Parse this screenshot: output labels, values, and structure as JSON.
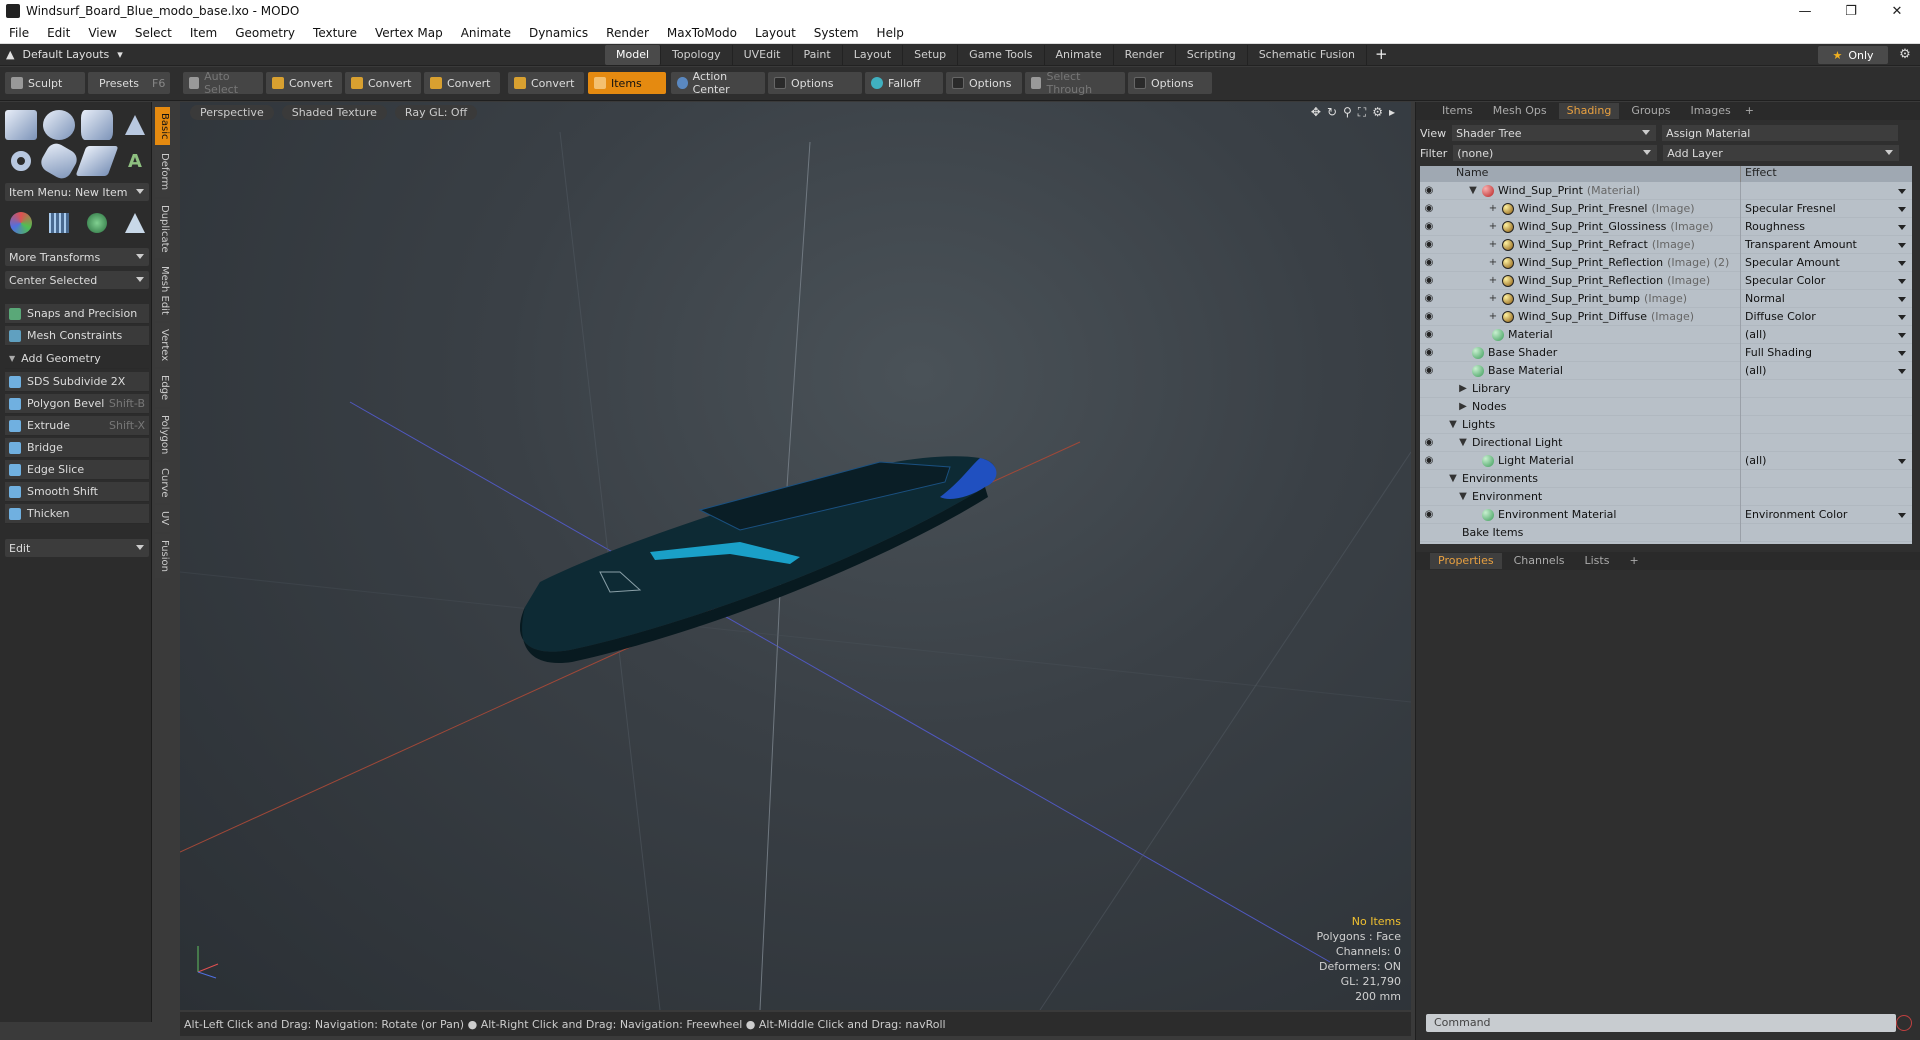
{
  "window": {
    "title": "Windsurf_Board_Blue_modo_base.lxo - MODO"
  },
  "menu": [
    "File",
    "Edit",
    "View",
    "Select",
    "Item",
    "Geometry",
    "Texture",
    "Vertex Map",
    "Animate",
    "Dynamics",
    "Render",
    "MaxToModo",
    "Layout",
    "System",
    "Help"
  ],
  "layout": {
    "default_layouts": "Default Layouts",
    "tabs": [
      "Model",
      "Topology",
      "UVEdit",
      "Paint",
      "Layout",
      "Setup",
      "Game Tools",
      "Animate",
      "Render",
      "Scripting",
      "Schematic Fusion"
    ],
    "active_tab": "Model",
    "only_label": "Only"
  },
  "toolbar": {
    "sculpt": "Sculpt",
    "presets": "Presets",
    "presets_key": "F6",
    "auto_select": "Auto Select",
    "convert": "Convert",
    "items": "Items",
    "action_center": "Action Center",
    "options": "Options",
    "falloff": "Falloff",
    "select_through": "Select Through"
  },
  "left": {
    "item_menu": "Item Menu: New Item",
    "more_transforms": "More Transforms",
    "center_selected": "Center Selected",
    "snaps": "Snaps and Precision",
    "mesh_constraints": "Mesh Constraints",
    "add_geometry": "Add Geometry",
    "tools": [
      {
        "label": "SDS Subdivide 2X",
        "key": ""
      },
      {
        "label": "Polygon Bevel",
        "key": "Shift-B"
      },
      {
        "label": "Extrude",
        "key": "Shift-X"
      },
      {
        "label": "Bridge",
        "key": ""
      },
      {
        "label": "Edge Slice",
        "key": ""
      },
      {
        "label": "Smooth Shift",
        "key": ""
      },
      {
        "label": "Thicken",
        "key": ""
      }
    ],
    "edit": "Edit",
    "side_tabs": [
      "Basic",
      "Deform",
      "Duplicate",
      "Mesh Edit",
      "Vertex",
      "Edge",
      "Polygon",
      "Curve",
      "UV",
      "Fusion"
    ]
  },
  "viewport": {
    "perspective": "Perspective",
    "shaded": "Shaded Texture",
    "raygl": "Ray GL: Off",
    "stats": {
      "items": "No Items",
      "polygons": "Polygons : Face",
      "channels": "Channels: 0",
      "deformers": "Deformers: ON",
      "gl": "GL: 21,790",
      "scale": "200 mm"
    },
    "status": "Alt-Left Click and Drag: Navigation: Rotate (or Pan) ● Alt-Right Click and Drag: Navigation: Freewheel ● Alt-Middle Click and Drag: navRoll"
  },
  "right": {
    "tabs": [
      "Items",
      "Mesh Ops",
      "Shading",
      "Groups",
      "Images"
    ],
    "active_tab": "Shading",
    "view_label": "View",
    "view_value": "Shader Tree",
    "assign_material": "Assign Material",
    "filter_label": "Filter",
    "filter_value": "(none)",
    "add_layer": "Add Layer",
    "col_name": "Name",
    "col_effect": "Effect",
    "tree": [
      {
        "name": "Wind_Sup_Print",
        "type": "(Material)",
        "effect": "",
        "eye": true,
        "indent": 3,
        "ball": "red",
        "expander": "▼",
        "arrow": true
      },
      {
        "name": "Wind_Sup_Print_Fresnel",
        "type": "(Image)",
        "effect": "Specular Fresnel",
        "eye": true,
        "indent": 5,
        "ball": "img",
        "expander": "+",
        "arrow": true
      },
      {
        "name": "Wind_Sup_Print_Glossiness",
        "type": "(Image)",
        "effect": "Roughness",
        "eye": true,
        "indent": 5,
        "ball": "img",
        "expander": "+",
        "arrow": true
      },
      {
        "name": "Wind_Sup_Print_Refract",
        "type": "(Image)",
        "effect": "Transparent Amount",
        "eye": true,
        "indent": 5,
        "ball": "img",
        "expander": "+",
        "arrow": true
      },
      {
        "name": "Wind_Sup_Print_Reflection",
        "type": "(Image) (2)",
        "effect": "Specular Amount",
        "eye": true,
        "indent": 5,
        "ball": "img",
        "expander": "+",
        "arrow": true
      },
      {
        "name": "Wind_Sup_Print_Reflection",
        "type": "(Image)",
        "effect": "Specular Color",
        "eye": true,
        "indent": 5,
        "ball": "img",
        "expander": "+",
        "arrow": true
      },
      {
        "name": "Wind_Sup_Print_bump",
        "type": "(Image)",
        "effect": "Normal",
        "eye": true,
        "indent": 5,
        "ball": "img",
        "expander": "+",
        "arrow": true
      },
      {
        "name": "Wind_Sup_Print_Diffuse",
        "type": "(Image)",
        "effect": "Diffuse Color",
        "eye": true,
        "indent": 5,
        "ball": "img",
        "expander": "+",
        "arrow": true
      },
      {
        "name": "Material",
        "type": "",
        "effect": "(all)",
        "eye": true,
        "indent": 4,
        "ball": "green",
        "expander": "",
        "arrow": true
      },
      {
        "name": "Base Shader",
        "type": "",
        "effect": "Full Shading",
        "eye": true,
        "indent": 2,
        "ball": "green",
        "expander": "",
        "arrow": true
      },
      {
        "name": "Base Material",
        "type": "",
        "effect": "(all)",
        "eye": true,
        "indent": 2,
        "ball": "green",
        "expander": "",
        "arrow": true
      },
      {
        "name": "Library",
        "type": "",
        "effect": "",
        "eye": false,
        "indent": 2,
        "ball": "",
        "expander": "▶",
        "arrow": false
      },
      {
        "name": "Nodes",
        "type": "",
        "effect": "",
        "eye": false,
        "indent": 2,
        "ball": "",
        "expander": "▶",
        "arrow": false
      },
      {
        "name": "Lights",
        "type": "",
        "effect": "",
        "eye": false,
        "indent": 1,
        "ball": "",
        "expander": "▼",
        "arrow": false
      },
      {
        "name": "Directional Light",
        "type": "",
        "effect": "",
        "eye": true,
        "indent": 2,
        "ball": "",
        "expander": "▼",
        "arrow": false
      },
      {
        "name": "Light Material",
        "type": "",
        "effect": "(all)",
        "eye": true,
        "indent": 3,
        "ball": "green",
        "expander": "",
        "arrow": true
      },
      {
        "name": "Environments",
        "type": "",
        "effect": "",
        "eye": false,
        "indent": 1,
        "ball": "",
        "expander": "▼",
        "arrow": false
      },
      {
        "name": "Environment",
        "type": "",
        "effect": "",
        "eye": false,
        "indent": 2,
        "ball": "",
        "expander": "▼",
        "arrow": false
      },
      {
        "name": "Environment Material",
        "type": "",
        "effect": "Environment Color",
        "eye": true,
        "indent": 3,
        "ball": "green",
        "expander": "",
        "arrow": true
      },
      {
        "name": "Bake Items",
        "type": "",
        "effect": "",
        "eye": false,
        "indent": 1,
        "ball": "",
        "expander": "",
        "arrow": false
      }
    ],
    "prop_tabs": [
      "Properties",
      "Channels",
      "Lists"
    ],
    "command_placeholder": "Command"
  }
}
